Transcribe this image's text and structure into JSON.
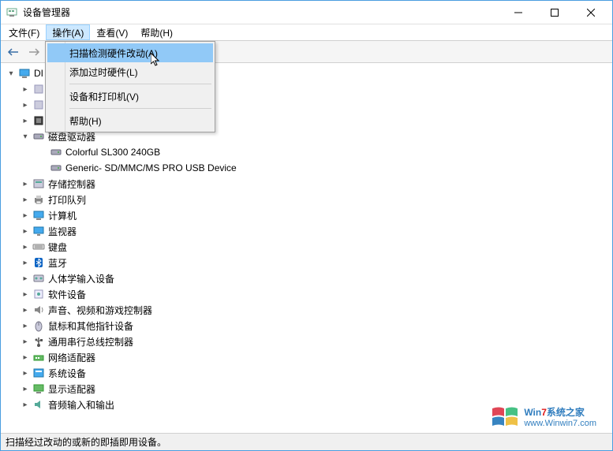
{
  "window": {
    "title": "设备管理器"
  },
  "menubar": {
    "file": "文件(F)",
    "action": "操作(A)",
    "view": "查看(V)",
    "help": "帮助(H)"
  },
  "dropdown": {
    "scan": "扫描检测硬件改动(A)",
    "add_legacy": "添加过时硬件(L)",
    "devices_printers": "设备和打印机(V)",
    "help": "帮助(H)"
  },
  "tree": {
    "root": "DI",
    "items": [
      {
        "label": "",
        "expanded": false,
        "depth": 1,
        "icon": "generic"
      },
      {
        "label": "",
        "expanded": false,
        "depth": 1,
        "icon": "generic"
      },
      {
        "label": "处理器",
        "expanded": false,
        "depth": 1,
        "icon": "cpu"
      },
      {
        "label": "磁盘驱动器",
        "expanded": true,
        "depth": 1,
        "icon": "disk"
      },
      {
        "label": "Colorful SL300 240GB",
        "depth": 2,
        "icon": "disk"
      },
      {
        "label": "Generic- SD/MMC/MS PRO USB Device",
        "depth": 2,
        "icon": "disk"
      },
      {
        "label": "存储控制器",
        "expanded": false,
        "depth": 1,
        "icon": "storage"
      },
      {
        "label": "打印队列",
        "expanded": false,
        "depth": 1,
        "icon": "printer"
      },
      {
        "label": "计算机",
        "expanded": false,
        "depth": 1,
        "icon": "computer"
      },
      {
        "label": "监视器",
        "expanded": false,
        "depth": 1,
        "icon": "monitor"
      },
      {
        "label": "键盘",
        "expanded": false,
        "depth": 1,
        "icon": "keyboard"
      },
      {
        "label": "蓝牙",
        "expanded": false,
        "depth": 1,
        "icon": "bluetooth"
      },
      {
        "label": "人体学输入设备",
        "expanded": false,
        "depth": 1,
        "icon": "hid"
      },
      {
        "label": "软件设备",
        "expanded": false,
        "depth": 1,
        "icon": "software"
      },
      {
        "label": "声音、视频和游戏控制器",
        "expanded": false,
        "depth": 1,
        "icon": "sound"
      },
      {
        "label": "鼠标和其他指针设备",
        "expanded": false,
        "depth": 1,
        "icon": "mouse"
      },
      {
        "label": "通用串行总线控制器",
        "expanded": false,
        "depth": 1,
        "icon": "usb"
      },
      {
        "label": "网络适配器",
        "expanded": false,
        "depth": 1,
        "icon": "network"
      },
      {
        "label": "系统设备",
        "expanded": false,
        "depth": 1,
        "icon": "system"
      },
      {
        "label": "显示适配器",
        "expanded": false,
        "depth": 1,
        "icon": "display"
      },
      {
        "label": "音频输入和输出",
        "expanded": false,
        "depth": 1,
        "icon": "audio"
      }
    ]
  },
  "statusbar": {
    "text": "扫描经过改动的或新的即插即用设备。"
  },
  "watermark": {
    "brand_prefix": "Win",
    "brand_num": "7",
    "brand_suffix": "系统之家",
    "url": "www.Winwin7.com"
  },
  "colors": {
    "highlight": "#91c9f7",
    "border": "#4a9de0"
  }
}
